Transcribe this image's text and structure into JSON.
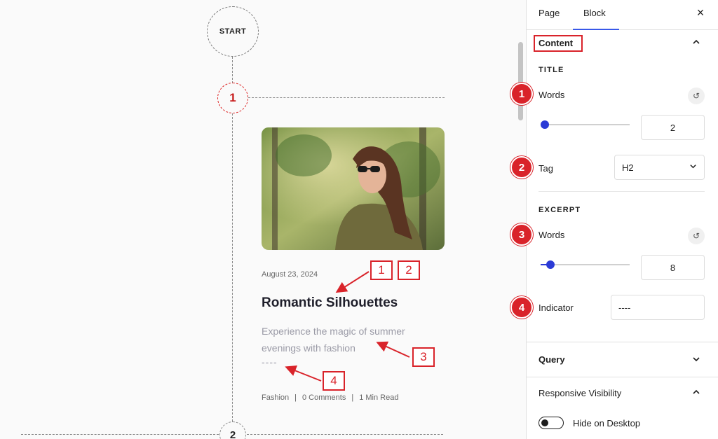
{
  "canvas": {
    "start_label": "START",
    "step1_label": "1",
    "step2_label": "2",
    "post": {
      "date": "August 23, 2024",
      "title": "Romantic Silhouettes",
      "excerpt": "Experience the magic of summer evenings with fashion",
      "indicator": "----",
      "meta": {
        "category": "Fashion",
        "comments": "0 Comments",
        "read": "1 Min Read",
        "separator": "|"
      }
    },
    "callouts": [
      "1",
      "2",
      "3",
      "4"
    ]
  },
  "sidebar": {
    "tabs": [
      {
        "label": "Page"
      },
      {
        "label": "Block"
      }
    ],
    "active_tab": "Block",
    "close_icon": "×",
    "content": {
      "title": "Content",
      "title_group": {
        "label": "TITLE",
        "words_label": "Words",
        "words_value": "2",
        "words_fraction": 0.0,
        "tag_label": "Tag",
        "tag_value": "H2"
      },
      "excerpt_group": {
        "label": "EXCERPT",
        "words_label": "Words",
        "words_value": "8",
        "words_fraction": 0.06,
        "indicator_label": "Indicator",
        "indicator_value": "----"
      }
    },
    "query": {
      "title": "Query"
    },
    "responsive": {
      "title": "Responsive Visibility",
      "hide_desktop_label": "Hide on Desktop",
      "hide_desktop_on": false
    },
    "badges": [
      "1",
      "2",
      "3",
      "4"
    ],
    "accent_color": "#3858e9",
    "annotation_color": "#d9232a"
  }
}
